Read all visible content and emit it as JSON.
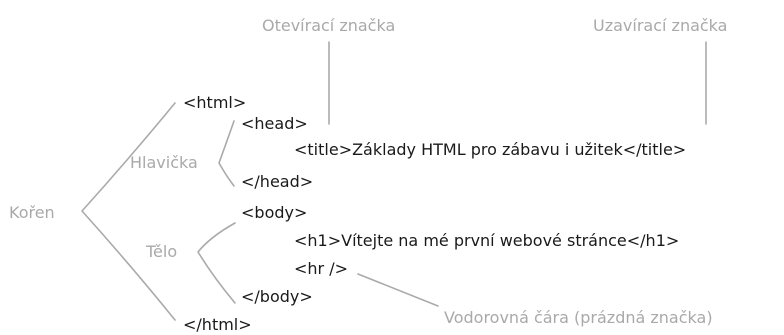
{
  "labels": {
    "opening_tag": "Otevírací značka",
    "closing_tag": "Uzavírací značka",
    "head": "Hlavička",
    "root": "Kořen",
    "body": "Tělo",
    "hr": "Vodorovná čára (prázdná značka)"
  },
  "code": {
    "html_open": "<html>",
    "head_open": "<head>",
    "title_line": "<title>Základy HTML pro zábavu i užitek</title>",
    "head_close": "</head>",
    "body_open": "<body>",
    "h1_line": "<h1>Vítejte na mé první webové stránce</h1>",
    "hr_line": "<hr />",
    "body_close": "</body>",
    "html_close": "</html>"
  },
  "colors": {
    "code_text": "#1a1a1a",
    "annotation_text": "#a9a9a9",
    "connector_line": "#aaaaaa"
  }
}
